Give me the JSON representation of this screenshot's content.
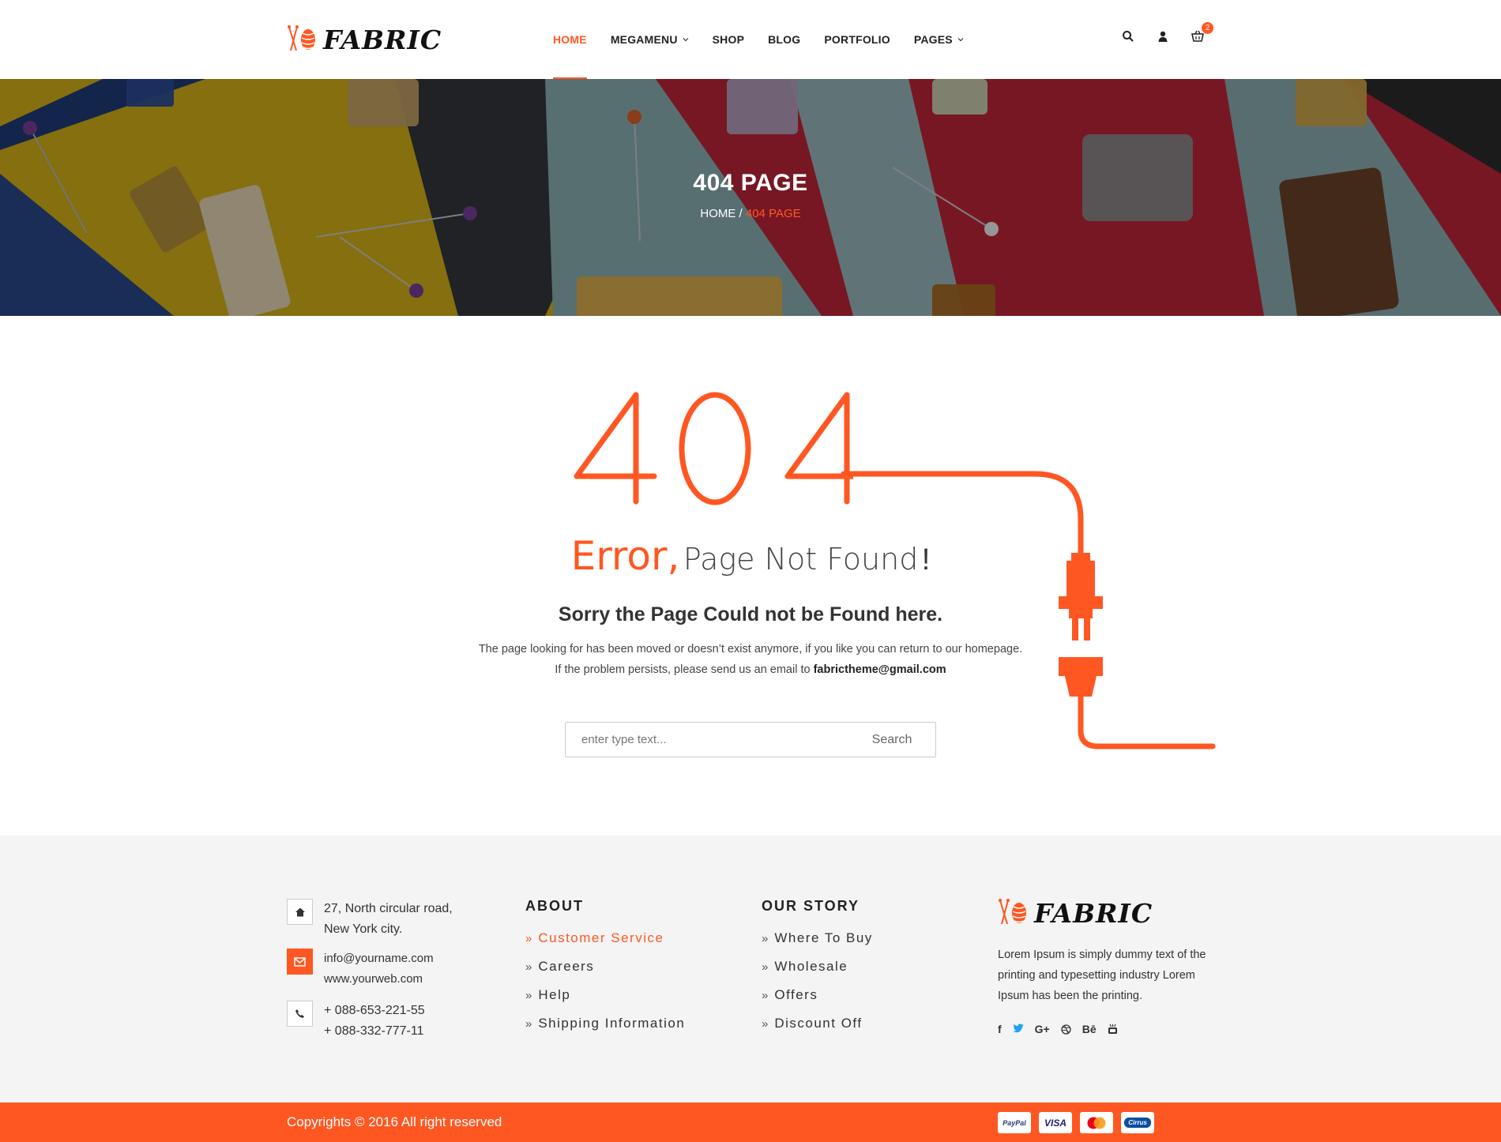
{
  "header": {
    "logo_text": "FABRIC",
    "nav": [
      {
        "label": "HOME",
        "active": true,
        "dropdown": false
      },
      {
        "label": "MEGAMENU",
        "active": false,
        "dropdown": true
      },
      {
        "label": "SHOP",
        "active": false,
        "dropdown": false
      },
      {
        "label": "BLOG",
        "active": false,
        "dropdown": false
      },
      {
        "label": "PORTFOLIO",
        "active": false,
        "dropdown": false
      },
      {
        "label": "PAGES",
        "active": false,
        "dropdown": true
      }
    ],
    "cart_count": "2",
    "icons": [
      "search-icon",
      "user-icon",
      "cart-icon"
    ]
  },
  "hero": {
    "title": "404 PAGE",
    "breadcrumb_home": "HOME",
    "breadcrumb_sep": " / ",
    "breadcrumb_current": "404 PAGE"
  },
  "main": {
    "code": "404",
    "error_word": "Error,",
    "error_rest": "Page Not Found",
    "error_bang": "!",
    "sorry": "Sorry the Page Could not be Found here.",
    "para_line1": "The page looking for has been moved or doesn’t exist anymore, if you like you can return to our homepage.",
    "para_line2": "If the problem persists, please send us an email to",
    "email": "fabrictheme@gmail.com",
    "search_placeholder": "enter type text...",
    "search_button": "Search"
  },
  "footer": {
    "address_line1": "27, North circular road,",
    "address_line2": "New York city.",
    "email": "info@yourname.com",
    "web": "www.yourweb.com",
    "phone1": "+ 088-653-221-55",
    "phone2": "+ 088-332-777-11",
    "about_title": "ABOUT",
    "about_links": [
      "Customer Service",
      "Careers",
      "Help",
      "Shipping Information"
    ],
    "story_title": "OUR STORY",
    "story_links": [
      "Where To Buy",
      "Wholesale",
      "Offers",
      "Discount Off"
    ],
    "logo_text": "FABRIC",
    "description": "Lorem Ipsum is simply dummy text of the printing and typesetting industry Lorem Ipsum has been the printing.",
    "social": [
      "f",
      "t",
      "G+",
      "dribbble",
      "Bē",
      "youtube"
    ],
    "copyright": "Copyrights © 2016 All right reserved",
    "payments": [
      "PayPal",
      "VISA",
      "MasterCard",
      "Cirrus"
    ]
  },
  "colors": {
    "accent": "#ff5722",
    "footer_bg": "#f4f4f4",
    "text": "#333333"
  }
}
